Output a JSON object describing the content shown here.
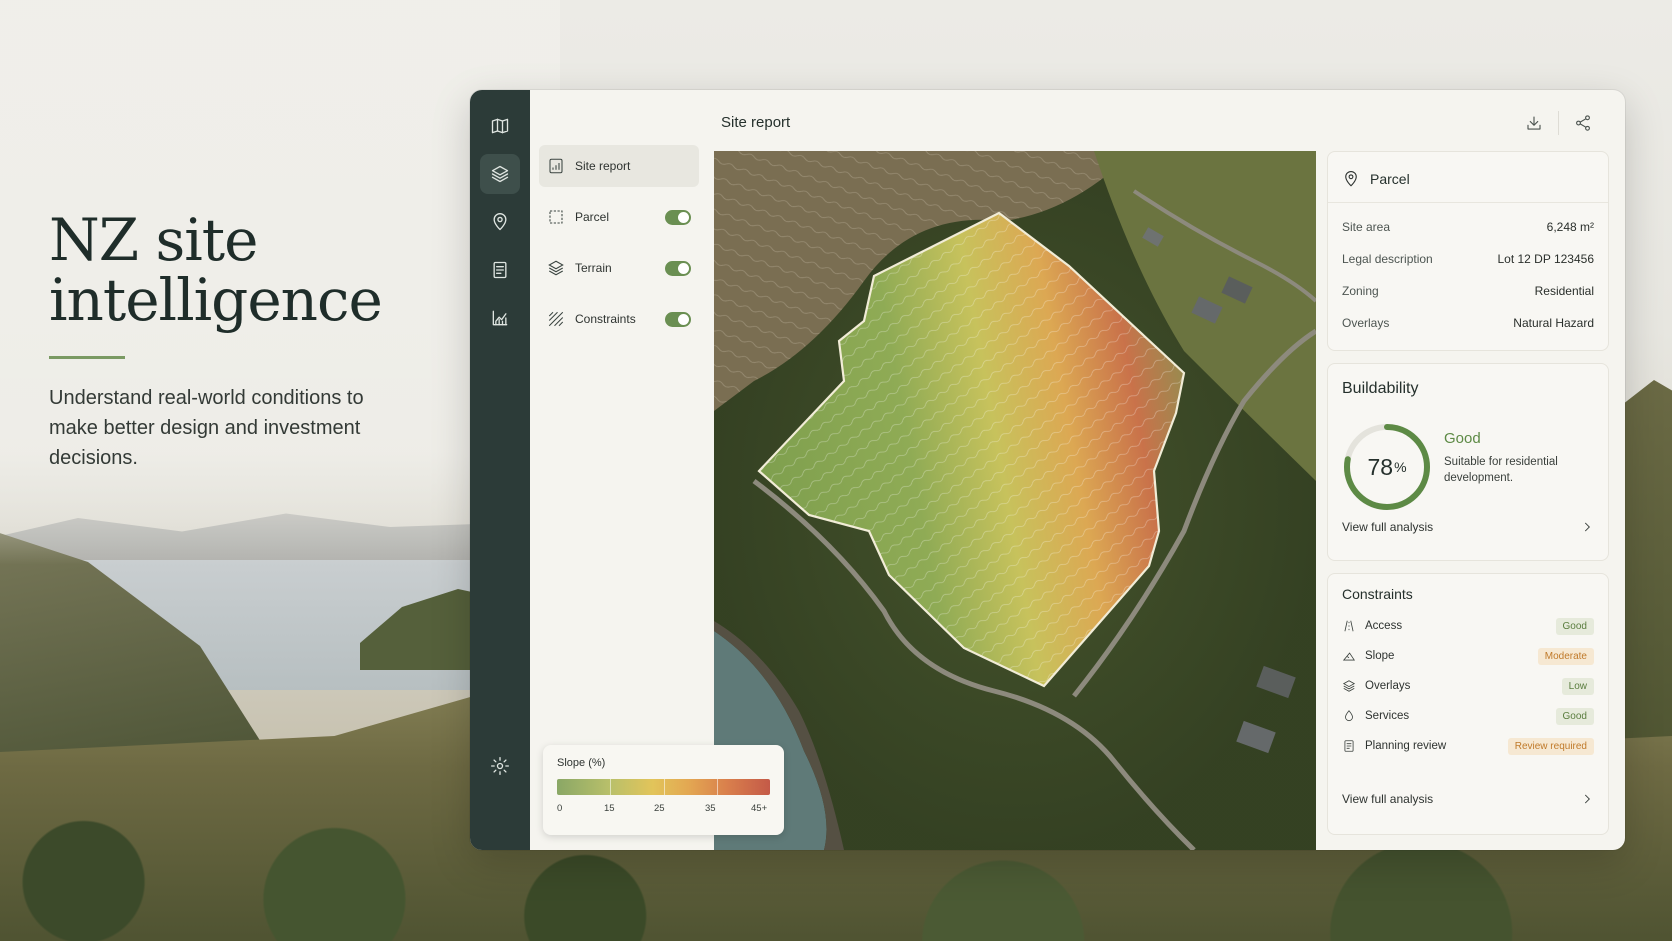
{
  "hero": {
    "title_line1": "NZ site",
    "title_line2": "intelligence",
    "subtitle": "Understand real-world conditions to make better design and investment decisions."
  },
  "rail": {
    "icons": [
      "map-icon",
      "layers-icon",
      "pin-icon",
      "document-icon",
      "chart-icon",
      "settings-icon"
    ],
    "active": "layers-icon"
  },
  "layers_panel": {
    "items": [
      {
        "label": "Site report",
        "icon": "report-icon",
        "active": true
      },
      {
        "label": "Parcel",
        "icon": "parcel-icon",
        "toggle": true
      },
      {
        "label": "Terrain",
        "icon": "terrain-icon",
        "toggle": true
      },
      {
        "label": "Constraints",
        "icon": "hatch-icon",
        "toggle": true
      }
    ]
  },
  "topbar": {
    "title": "Site report",
    "actions": [
      "download-icon",
      "share-icon"
    ]
  },
  "legend": {
    "title": "Slope (%)",
    "ticks": [
      "0",
      "15",
      "25",
      "35",
      "45+"
    ],
    "colors": [
      "#8aa766",
      "#b9c06a",
      "#e2c45a",
      "#e3a752",
      "#d97f4c",
      "#c45a48"
    ]
  },
  "parcel": {
    "title": "Parcel",
    "rows": [
      {
        "key": "Site area",
        "value": "6,248 m²"
      },
      {
        "key": "Legal description",
        "value": "Lot 12 DP 123456"
      },
      {
        "key": "Zoning",
        "value": "Residential"
      },
      {
        "key": "Overlays",
        "value": "Natural Hazard"
      }
    ]
  },
  "buildability": {
    "title": "Buildability",
    "score": "78",
    "score_unit": "%",
    "score_fraction": 0.78,
    "status": "Good",
    "description": "Suitable for residential development.",
    "link": "View full analysis",
    "accent": "#5d8a45"
  },
  "constraints": {
    "title": "Constraints",
    "items": [
      {
        "label": "Access",
        "badge": "Good",
        "tone": "good",
        "icon": "road-icon"
      },
      {
        "label": "Slope",
        "badge": "Moderate",
        "tone": "mod",
        "icon": "slope-icon"
      },
      {
        "label": "Overlays",
        "badge": "Low",
        "tone": "good",
        "icon": "layers-icon"
      },
      {
        "label": "Services",
        "badge": "Good",
        "tone": "good",
        "icon": "drop-icon"
      },
      {
        "label": "Planning review",
        "badge": "Review required",
        "tone": "mod",
        "icon": "document-icon"
      }
    ],
    "link": "View full analysis"
  }
}
